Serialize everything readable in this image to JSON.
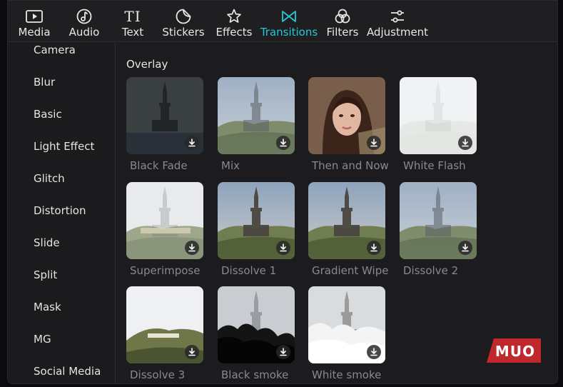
{
  "toolbar": {
    "tabs": [
      {
        "label": "Media",
        "icon": "media-icon",
        "active": false
      },
      {
        "label": "Audio",
        "icon": "audio-icon",
        "active": false
      },
      {
        "label": "Text",
        "icon": "text-icon",
        "active": false
      },
      {
        "label": "Stickers",
        "icon": "stickers-icon",
        "active": false
      },
      {
        "label": "Effects",
        "icon": "effects-icon",
        "active": false
      },
      {
        "label": "Transitions",
        "icon": "transitions-icon",
        "active": true
      },
      {
        "label": "Filters",
        "icon": "filters-icon",
        "active": false
      },
      {
        "label": "Adjustment",
        "icon": "adjustment-icon",
        "active": false
      }
    ],
    "text_icon_glyph": "TI",
    "active_color": "#27c6d9"
  },
  "sidebar": {
    "items": [
      {
        "label": "Camera"
      },
      {
        "label": "Blur"
      },
      {
        "label": "Basic"
      },
      {
        "label": "Light Effect"
      },
      {
        "label": "Glitch"
      },
      {
        "label": "Distortion"
      },
      {
        "label": "Slide"
      },
      {
        "label": "Split"
      },
      {
        "label": "Mask"
      },
      {
        "label": "MG"
      },
      {
        "label": "Social Media"
      }
    ]
  },
  "main": {
    "section_title": "Overlay",
    "transitions": [
      {
        "label": "Black Fade",
        "style": "dark"
      },
      {
        "label": "Mix",
        "style": "mix"
      },
      {
        "label": "Then and Now",
        "style": "portrait"
      },
      {
        "label": "White Flash",
        "style": "white"
      },
      {
        "label": "Superimpose",
        "style": "pale"
      },
      {
        "label": "Dissolve 1",
        "style": "tower"
      },
      {
        "label": "Gradient Wipe",
        "style": "tower"
      },
      {
        "label": "Dissolve 2",
        "style": "mix"
      },
      {
        "label": "Dissolve 3",
        "style": "hills"
      },
      {
        "label": "Black smoke",
        "style": "smoke"
      },
      {
        "label": "White smoke",
        "style": "whitesmoke"
      }
    ],
    "download_icon": "download-icon"
  },
  "watermark": {
    "text": "MUO",
    "color": "#c0282d"
  }
}
